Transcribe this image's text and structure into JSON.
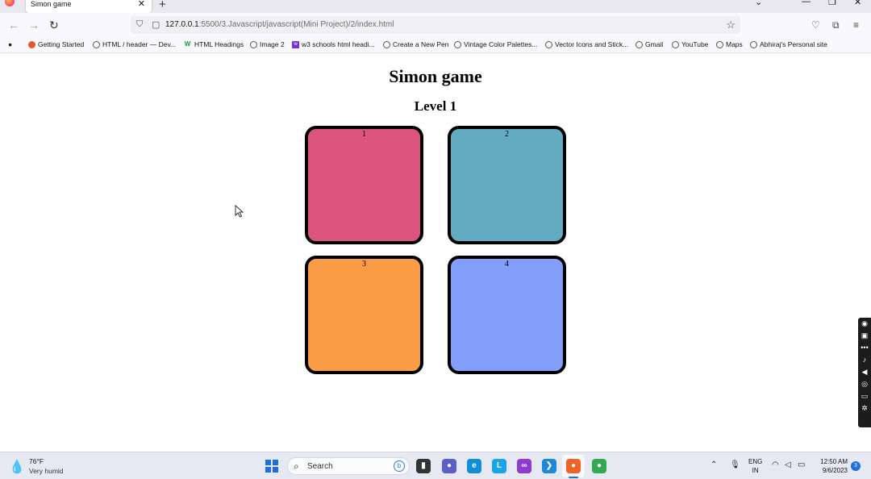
{
  "browser": {
    "tab_title": "Simon game",
    "tab_close": "✕",
    "new_tab": "+",
    "url_host": "127.0.0.1",
    "url_rest": ":5500/3.Javascript/javascript(Mini Project)/2/index.html",
    "bookmarks": [
      "Getting Started",
      "HTML / header — Dev...",
      "HTML Headings",
      "Image 2",
      "w3 schools html headi...",
      "Create a New Pen",
      "Vintage Color Palettes...",
      "Vector Icons and Stick...",
      "Gmail",
      "YouTube",
      "Maps",
      "Abhiraj's Personal site"
    ]
  },
  "game": {
    "title": "Simon game",
    "level": "Level 1",
    "boxes": [
      {
        "label": "1",
        "color": "#db557e"
      },
      {
        "label": "2",
        "color": "#63abc1"
      },
      {
        "label": "3",
        "color": "#f99c45"
      },
      {
        "label": "4",
        "color": "#829efa"
      }
    ]
  },
  "taskbar": {
    "weather_temp": "76°F",
    "weather_desc": "Very humid",
    "search_label": "Search",
    "lang_line1": "ENG",
    "lang_line2": "IN",
    "time": "12:50 AM",
    "date": "9/6/2023",
    "apps": [
      {
        "name": "files",
        "glyph": "▮",
        "color": "#333333"
      },
      {
        "name": "meet",
        "glyph": "●",
        "color": "#5b5fc7"
      },
      {
        "name": "edge",
        "glyph": "e",
        "color": "#0f8fd6"
      },
      {
        "name": "lens",
        "glyph": "L",
        "color": "#1aa3e8"
      },
      {
        "name": "infinity",
        "glyph": "∞",
        "color": "#8e3bd1"
      },
      {
        "name": "vscode",
        "glyph": "❯",
        "color": "#1e88d9"
      },
      {
        "name": "firefox",
        "glyph": "●",
        "color": "#f06225"
      },
      {
        "name": "chrome",
        "glyph": "●",
        "color": "#34a853"
      }
    ]
  }
}
